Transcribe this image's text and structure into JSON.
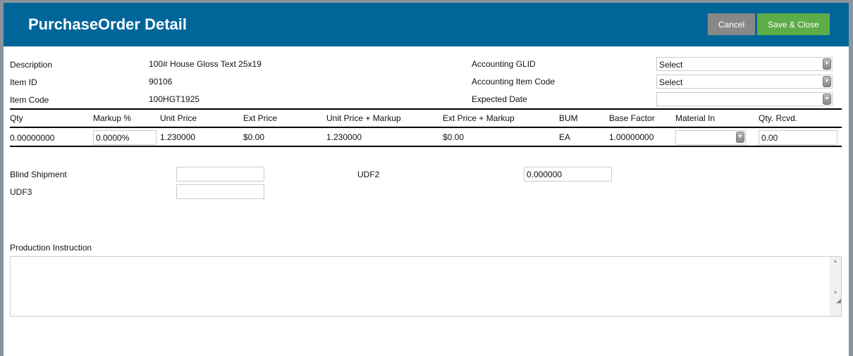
{
  "header": {
    "title": "PurchaseOrder Detail",
    "cancel": "Cancel",
    "save": "Save & Close"
  },
  "info": {
    "description_label": "Description",
    "description": "100# House Gloss Text 25x19",
    "item_id_label": "Item ID",
    "item_id": "90106",
    "item_code_label": "Item Code",
    "item_code": "100HGT1925",
    "glid_label": "Accounting GLID",
    "glid": "Select",
    "acct_item_label": "Accounting Item Code",
    "acct_item": "Select",
    "expected_label": "Expected Date",
    "expected": ""
  },
  "grid": {
    "columns": [
      "Qty",
      "Markup %",
      "Unit Price",
      "Ext Price",
      "Unit Price + Markup",
      "Ext Price + Markup",
      "BUM",
      "Base Factor",
      "Material In",
      "Qty. Rcvd."
    ],
    "row": {
      "qty": "0.00000000",
      "markup": "0.0000%",
      "unit_price": "1.230000",
      "ext_price": "$0.00",
      "unit_markup": "1.230000",
      "ext_markup": "$0.00",
      "bum": "EA",
      "base_factor": "1.00000000",
      "material_in": "",
      "qty_rcvd": "0.00"
    }
  },
  "extra": {
    "blind_label": "Blind Shipment",
    "blind": "",
    "udf2_label": "UDF2",
    "udf2": "0.000000",
    "udf3_label": "UDF3",
    "udf3": ""
  },
  "production": {
    "label": "Production Instruction",
    "value": ""
  },
  "colors": {
    "header": "#006699",
    "save": "#5cac48",
    "cancel": "#888888"
  }
}
